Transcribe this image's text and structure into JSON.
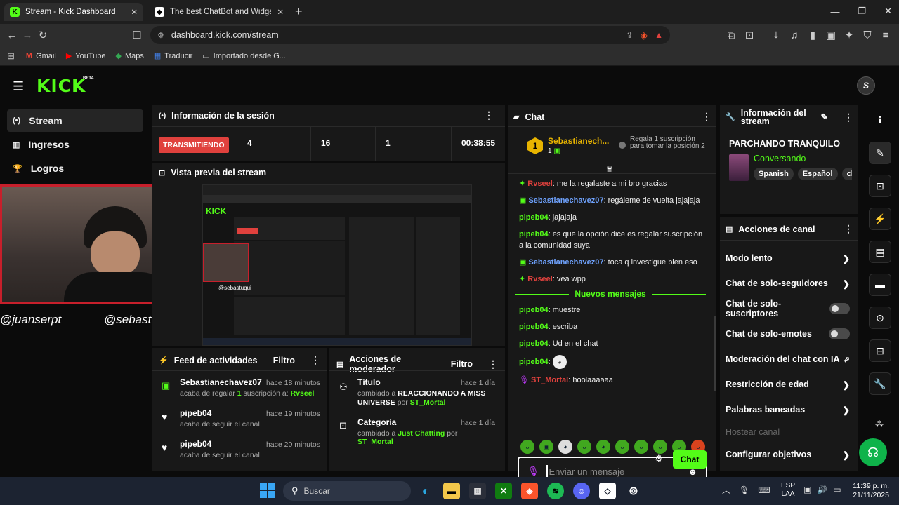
{
  "browser": {
    "tabs": [
      {
        "title": "Stream - Kick Dashboard",
        "favicon": "kick-icon"
      },
      {
        "title": "The best ChatBot and Widgets for Kic",
        "favicon": "bot-icon"
      }
    ],
    "url": "dashboard.kick.com/stream",
    "bookmarks": [
      "Gmail",
      "YouTube",
      "Maps",
      "Traducir",
      "Importado desde G..."
    ]
  },
  "kick": {
    "logo": "KICK",
    "beta": "BETA",
    "sidebar": [
      "Stream",
      "Ingresos",
      "Logros"
    ]
  },
  "session": {
    "title": "Información de la sesión",
    "status": "TRANSMITIENDO",
    "stats": [
      "4",
      "16",
      "1"
    ],
    "timer": "00:38:55"
  },
  "preview": {
    "title": "Vista previa del stream",
    "handles": [
      "@juanserpt",
      "@sebastuqui"
    ],
    "inner_handle": "@sebastuqui"
  },
  "feed": {
    "title": "Feed de actividades",
    "filter": "Filtro",
    "items": [
      {
        "user": "Sebastianechavez07",
        "time": "hace 18 minutos",
        "pre": "acaba de regalar ",
        "count": "1",
        "mid": " suscripción a: ",
        "target": "Rvseel",
        "icon": "gift-icon"
      },
      {
        "user": "pipeb04",
        "time": "hace 19 minutos",
        "desc": "acaba de seguir el canal",
        "icon": "heart-icon"
      },
      {
        "user": "pipeb04",
        "time": "hace 20 minutos",
        "desc": "acaba de seguir el canal",
        "icon": "heart-icon"
      }
    ]
  },
  "modactions": {
    "title": "Acciones de moderador",
    "filter": "Filtro",
    "items": [
      {
        "label": "Título",
        "time": "hace 1 día",
        "pre": "cambiado a ",
        "value": "REACCIONANDO A MISS UNIVERSE",
        "by": " por ",
        "who": "ST_Mortal"
      },
      {
        "label": "Categoría",
        "time": "hace 1 día",
        "pre": "cambiado a ",
        "value": "Just Chatting",
        "by": " por ",
        "who": "ST_Mortal"
      }
    ]
  },
  "chat": {
    "title": "Chat",
    "pinned_user": "Sebastianech...",
    "pinned_rank": "1",
    "pinned_count": "1",
    "gift_promo": "Regala 1 suscripción para tomar la posición 2",
    "messages": [
      {
        "user": "Rvseel",
        "text": ": me la regalaste a mi bro gracias",
        "color": "red"
      },
      {
        "user": "Sebastianechavez07",
        "text": ": regáleme de vuelta jajajaja",
        "color": "blue"
      },
      {
        "user": "pipeb04",
        "text": ": jajajaja",
        "color": "green"
      },
      {
        "user": "pipeb04",
        "text": ": es que la opción dice es regalar suscripción a la comunidad suya",
        "color": "green"
      },
      {
        "user": "Sebastianechavez07",
        "text": ": toca q investigue bien eso",
        "color": "blue"
      },
      {
        "user": "Rvseel",
        "text": ": vea wpp",
        "color": "red"
      }
    ],
    "new_messages_label": "Nuevos mensajes",
    "new_messages": [
      {
        "user": "pipeb04",
        "text": ": muestre",
        "color": "green"
      },
      {
        "user": "pipeb04",
        "text": ": escriba",
        "color": "green"
      },
      {
        "user": "pipeb04",
        "text": ": Ud en el chat",
        "color": "green"
      },
      {
        "user": "pipeb04",
        "text": ":",
        "color": "green"
      },
      {
        "user": "ST_Mortal",
        "text": ": hoolaaaaaa",
        "color": "red"
      }
    ],
    "input_placeholder": "Enviar un mensaje",
    "send": "Chat"
  },
  "streaminfo": {
    "title": "Información del stream",
    "stream_title": "PARCHANDO TRANQUILO",
    "category": "Conversando",
    "tags": [
      "Spanish",
      "Español",
      "chi"
    ]
  },
  "channel_actions": {
    "title": "Acciones de canal",
    "items": [
      {
        "label": "Modo lento",
        "kind": "arrow"
      },
      {
        "label": "Chat de solo-seguidores",
        "kind": "arrow"
      },
      {
        "label": "Chat de solo-suscriptores",
        "kind": "toggle"
      },
      {
        "label": "Chat de solo-emotes",
        "kind": "toggle"
      },
      {
        "label": "Moderación del chat con IA",
        "kind": "external"
      },
      {
        "label": "Restricción de edad",
        "kind": "arrow"
      },
      {
        "label": "Palabras baneadas",
        "kind": "arrow"
      },
      {
        "label": "Hostear canal",
        "kind": "disabled"
      },
      {
        "label": "Configurar objetivos",
        "kind": "arrow"
      }
    ]
  },
  "taskbar": {
    "search": "Buscar",
    "lang1": "ESP",
    "lang2": "LAA",
    "time": "11:39 p. m.",
    "date": "21/11/2025"
  },
  "colors": {
    "accent": "#53fc18",
    "live": "#e0413d",
    "panel": "#181818",
    "bg": "#0b0b0b"
  }
}
